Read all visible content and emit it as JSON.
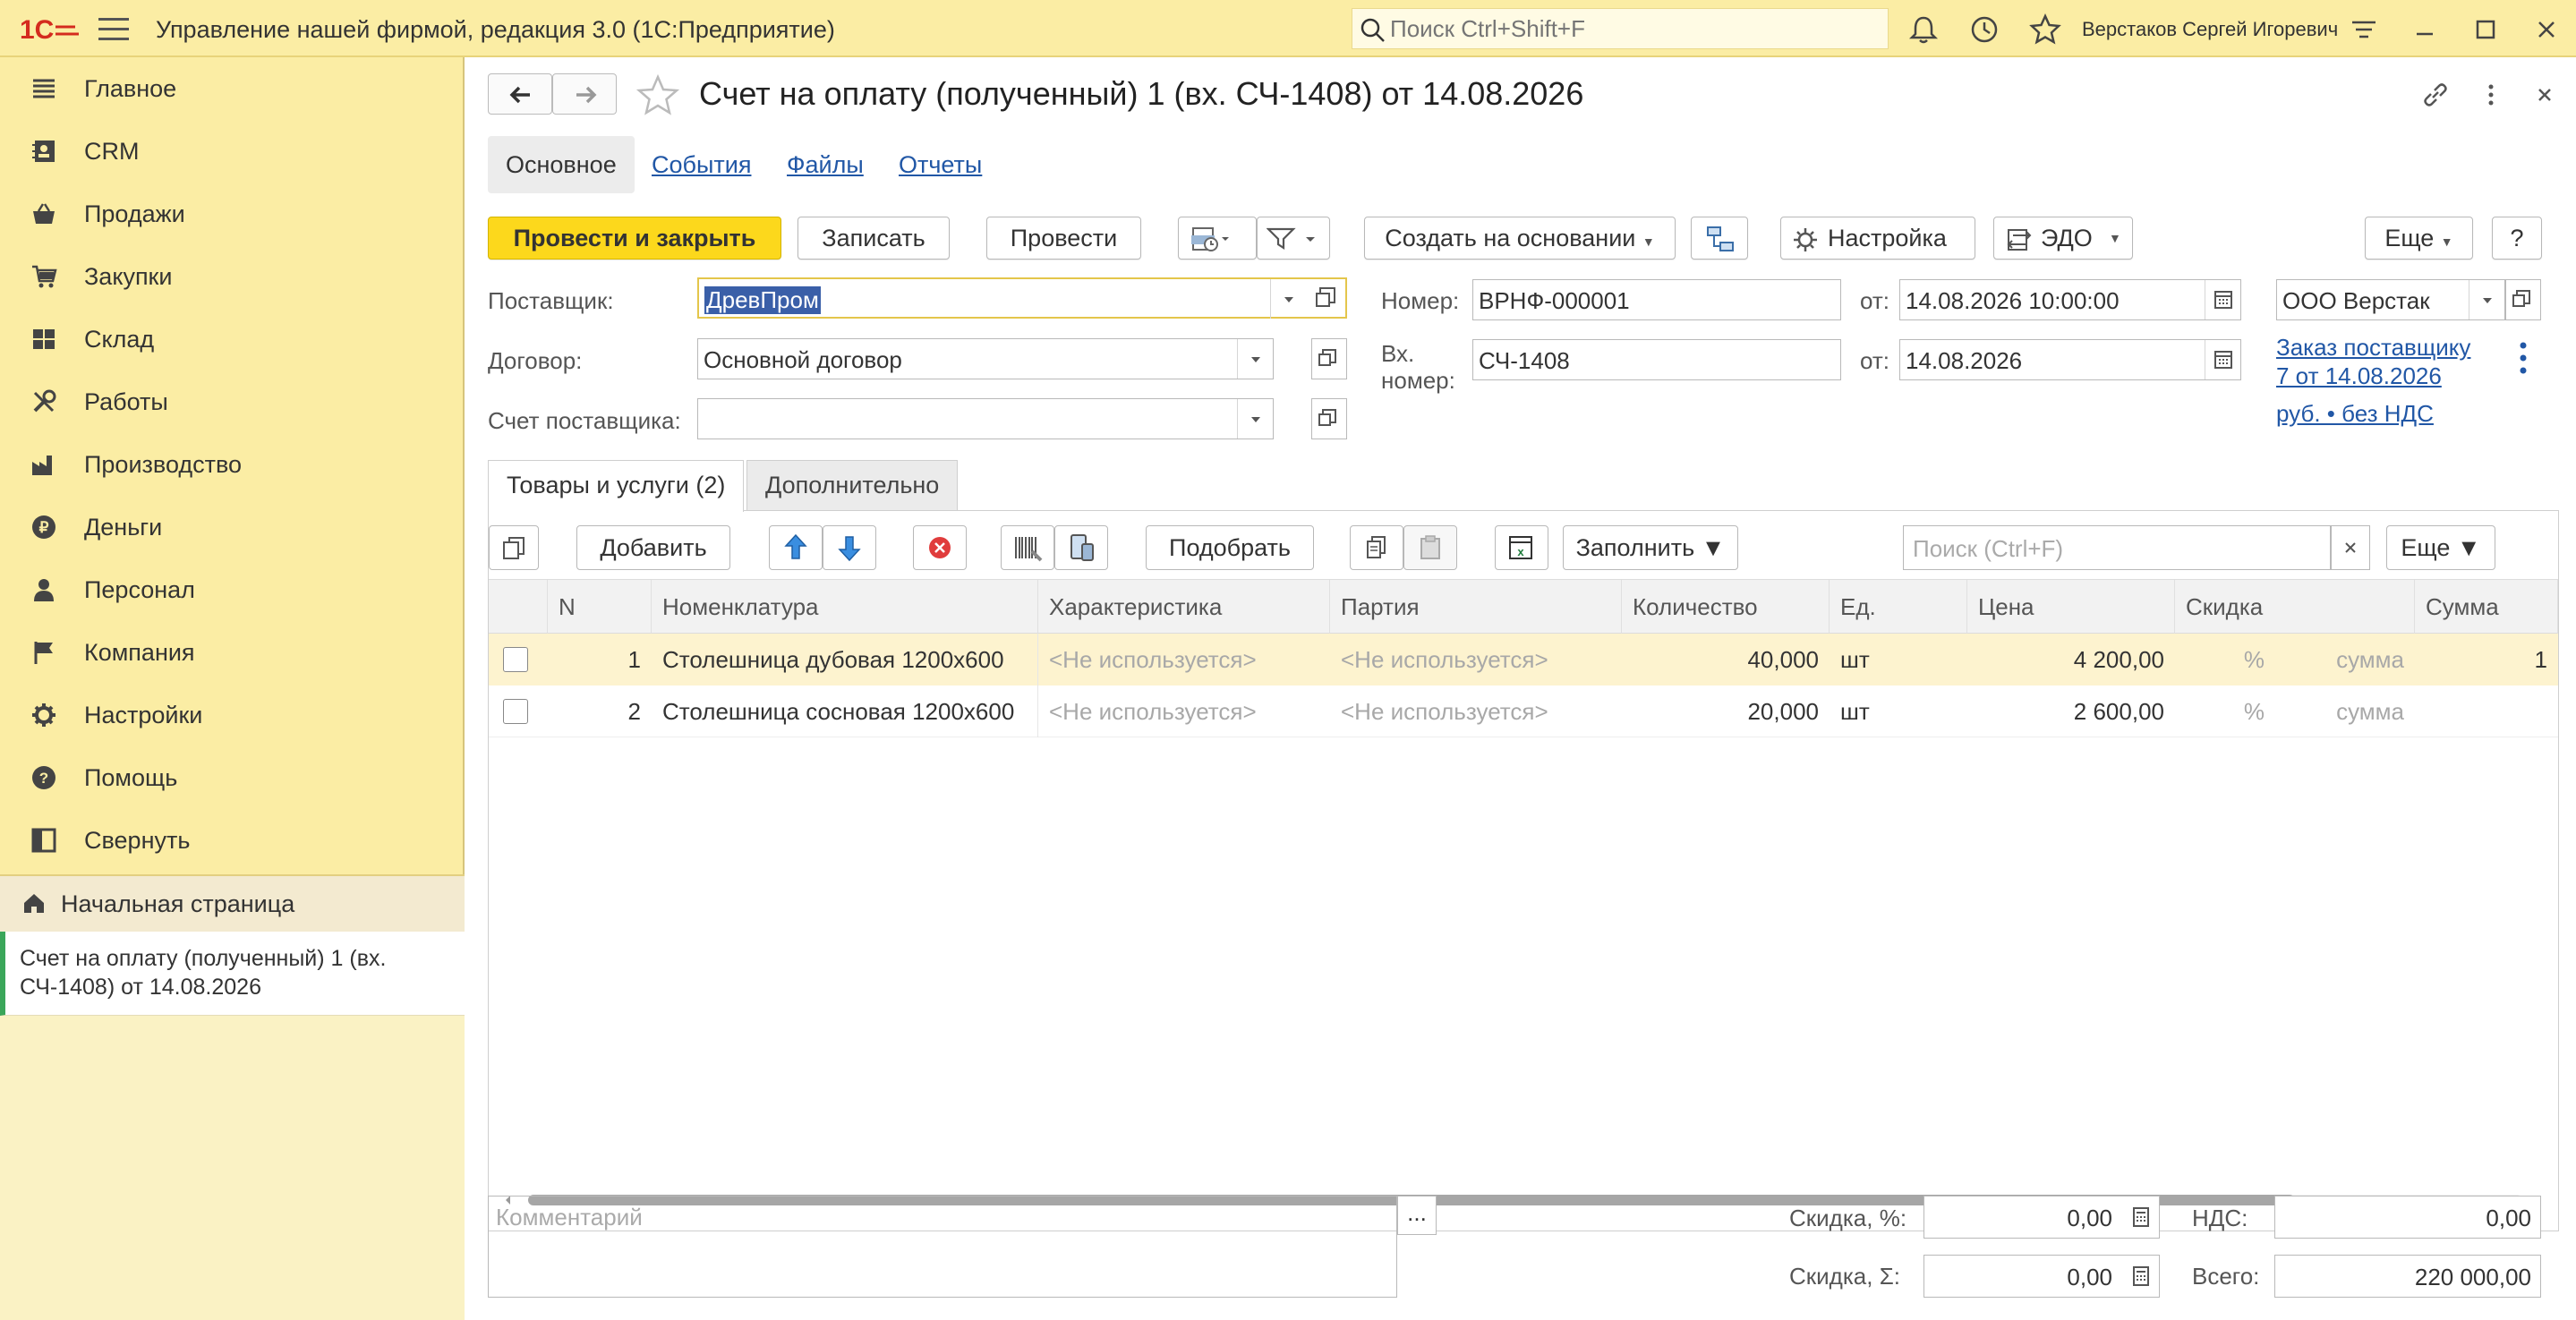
{
  "app": {
    "title": "Управление нашей фирмой, редакция 3.0  (1С:Предприятие)",
    "search_placeholder": "Поиск Ctrl+Shift+F",
    "user": "Верстаков Сергей Игоревич"
  },
  "sidebar": {
    "items": [
      {
        "label": "Главное",
        "icon": "list-icon"
      },
      {
        "label": "CRM",
        "icon": "contacts-icon"
      },
      {
        "label": "Продажи",
        "icon": "basket-icon"
      },
      {
        "label": "Закупки",
        "icon": "cart-icon"
      },
      {
        "label": "Склад",
        "icon": "warehouse-icon"
      },
      {
        "label": "Работы",
        "icon": "tools-icon"
      },
      {
        "label": "Производство",
        "icon": "factory-icon"
      },
      {
        "label": "Деньги",
        "icon": "money-icon"
      },
      {
        "label": "Персонал",
        "icon": "person-icon"
      },
      {
        "label": "Компания",
        "icon": "flag-icon"
      },
      {
        "label": "Настройки",
        "icon": "gear-icon"
      },
      {
        "label": "Помощь",
        "icon": "help-icon"
      },
      {
        "label": "Свернуть",
        "icon": "collapse-icon"
      }
    ],
    "home": "Начальная страница",
    "open_document": "Счет на оплату (полученный) 1 (вх. СЧ-1408) от 14.08.2026"
  },
  "document": {
    "title": "Счет на оплату (полученный) 1 (вх. СЧ-1408) от 14.08.2026",
    "tabs": [
      "Основное",
      "События",
      "Файлы",
      "Отчеты"
    ],
    "toolbar": {
      "post_close": "Провести и закрыть",
      "save": "Записать",
      "post": "Провести",
      "create_based": "Создать на основании",
      "settings": "Настройка",
      "edo": "ЭДО",
      "more": "Еще",
      "help": "?"
    },
    "fields": {
      "supplier_label": "Поставщик:",
      "supplier": "ДревПром",
      "contract_label": "Договор:",
      "contract": "Основной договор",
      "supplier_account_label": "Счет поставщика:",
      "supplier_account": "",
      "number_label": "Номер:",
      "number": "ВРНФ-000001",
      "from_label": "от:",
      "date": "14.08.2026 10:00:00",
      "in_number_label_1": "Вх.",
      "in_number_label_2": "номер:",
      "in_number": "СЧ-1408",
      "in_date": "14.08.2026",
      "organization": "ООО Верстак",
      "order_link_1": "Заказ поставщику",
      "order_link_2": "7 от 14.08.2026",
      "currency_link": "руб. • без НДС"
    },
    "inner_tabs": [
      "Товары и услуги (2)",
      "Дополнительно"
    ],
    "table_toolbar": {
      "add": "Добавить",
      "pick": "Подобрать",
      "fill": "Заполнить",
      "search_placeholder": "Поиск (Ctrl+F)",
      "more": "Еще"
    },
    "table": {
      "columns": [
        "N",
        "Номенклатура",
        "Характеристика",
        "Партия",
        "Количество",
        "Ед.",
        "Цена",
        "Скидка",
        "Сумма"
      ],
      "rows": [
        {
          "n": "1",
          "item": "Столешница дубовая 1200х600",
          "char": "<Не используется>",
          "batch": "<Не используется>",
          "qty": "40,000",
          "unit": "шт",
          "price": "4 200,00",
          "disc_pct": "%",
          "disc_sum": "сумма",
          "sum": "1"
        },
        {
          "n": "2",
          "item": "Столешница сосновая 1200х600",
          "char": "<Не используется>",
          "batch": "<Не используется>",
          "qty": "20,000",
          "unit": "шт",
          "price": "2 600,00",
          "disc_pct": "%",
          "disc_sum": "сумма",
          "sum": ""
        }
      ]
    },
    "footer": {
      "comment_placeholder": "Комментарий",
      "comment_button": "...",
      "discount_pct_label": "Скидка, %:",
      "discount_pct": "0,00",
      "discount_sum_label": "Скидка, Σ:",
      "discount_sum": "0,00",
      "vat_label": "НДС:",
      "vat": "0,00",
      "total_label": "Всего:",
      "total": "220 000,00"
    }
  },
  "colors": {
    "panel_yellow": "#fbeda4",
    "primary_button": "#fcd81c",
    "link_blue": "#2157a6",
    "selected_row": "#fdf3cf",
    "active_marker": "#3aa65a"
  }
}
